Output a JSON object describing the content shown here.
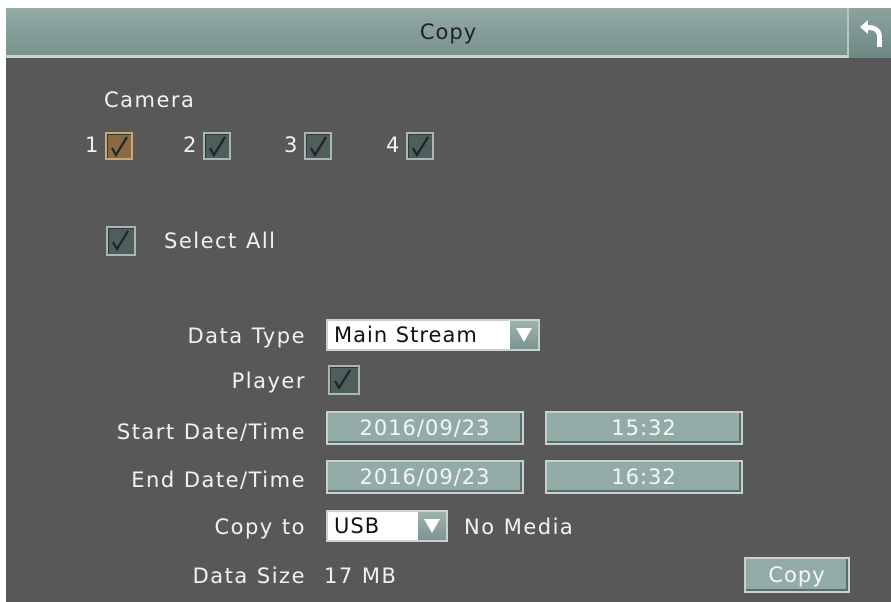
{
  "window": {
    "title": "Copy"
  },
  "camera": {
    "heading": "Camera",
    "items": [
      {
        "label": "1",
        "checked": true
      },
      {
        "label": "2",
        "checked": true
      },
      {
        "label": "3",
        "checked": true
      },
      {
        "label": "4",
        "checked": true
      }
    ]
  },
  "select_all": {
    "label": "Select All",
    "checked": true
  },
  "form": {
    "data_type_label": "Data Type",
    "data_type_value": "Main Stream",
    "player_label": "Player",
    "player_checked": true,
    "start_label": "Start Date/Time",
    "start_date": "2016/09/23",
    "start_time": "15:32",
    "end_label": "End Date/Time",
    "end_date": "2016/09/23",
    "end_time": "16:32",
    "copy_to_label": "Copy to",
    "copy_to_value": "USB",
    "media_status": "No Media",
    "data_size_label": "Data Size",
    "data_size_value": "17 MB",
    "copy_button": "Copy"
  },
  "icons": {
    "back": "back-arrow-icon",
    "check": "checkmark-icon",
    "dropdown": "dropdown-arrow-icon"
  },
  "colors": {
    "background": "#585858",
    "titlebar": "#86a09b",
    "button": "#93aba6",
    "checkbox_active": "#8a6a44"
  }
}
